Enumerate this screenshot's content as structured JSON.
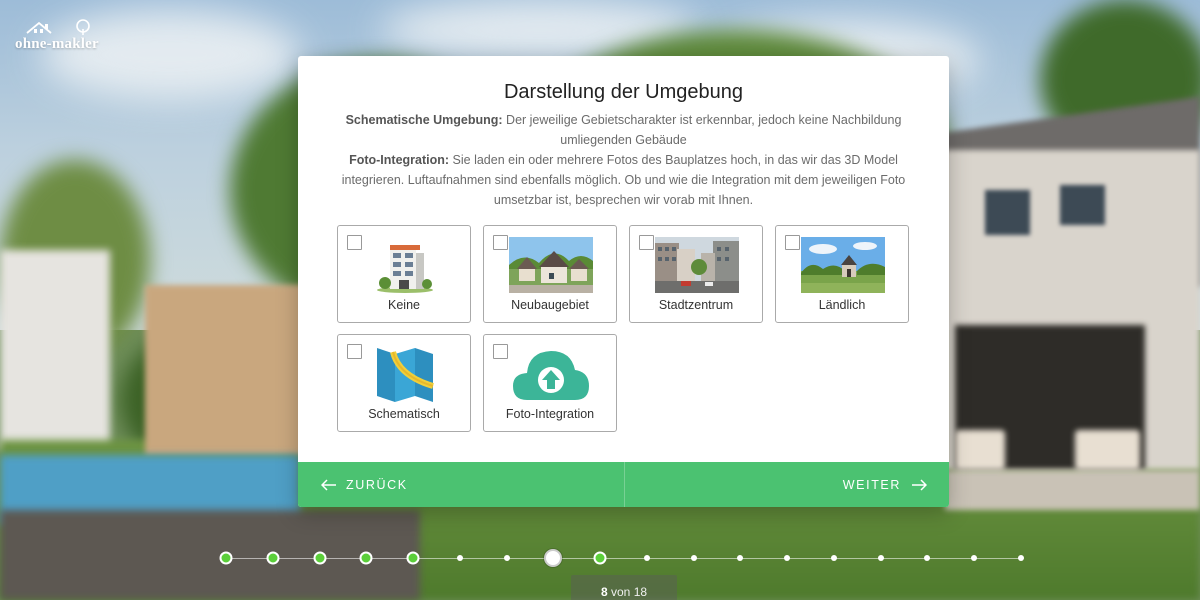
{
  "logo": {
    "text": "ohne-makler"
  },
  "dialog": {
    "title": "Darstellung der Umgebung",
    "desc1_bold": "Schematische Umgebung:",
    "desc1_text": " Der jeweilige Gebietscharakter ist erkennbar, jedoch keine Nachbildung umliegenden Gebäude",
    "desc2_bold": "Foto-Integration:",
    "desc2_text": " Sie laden ein oder mehrere Fotos des Bauplatzes hoch, in das wir das 3D Model integrieren. Luftaufnahmen sind ebenfalls möglich. Ob und wie die Integration mit dem jeweiligen Foto umsetzbar ist, besprechen wir vorab mit Ihnen.",
    "options": [
      {
        "label": "Keine",
        "icon": "apartment-building-icon",
        "checked": false
      },
      {
        "label": "Neubaugebiet",
        "icon": "new-housing-area-photo",
        "checked": false
      },
      {
        "label": "Stadtzentrum",
        "icon": "city-center-photo",
        "checked": false
      },
      {
        "label": "Ländlich",
        "icon": "rural-photo",
        "checked": false
      },
      {
        "label": "Schematisch",
        "icon": "map-icon",
        "checked": false
      },
      {
        "label": "Foto-Integration",
        "icon": "cloud-upload-icon",
        "checked": false
      }
    ]
  },
  "footer": {
    "back_label": "ZURÜCK",
    "next_label": "WEITER"
  },
  "progress": {
    "current": "8",
    "separator": "von",
    "total": "18",
    "steps": [
      "done",
      "done",
      "done",
      "done",
      "done",
      "todo",
      "todo",
      "current",
      "done",
      "todo",
      "todo",
      "todo",
      "todo",
      "todo",
      "todo",
      "todo",
      "todo",
      "todo"
    ]
  },
  "colors": {
    "accent": "#4bc271",
    "step_done": "#5bcf3a"
  }
}
